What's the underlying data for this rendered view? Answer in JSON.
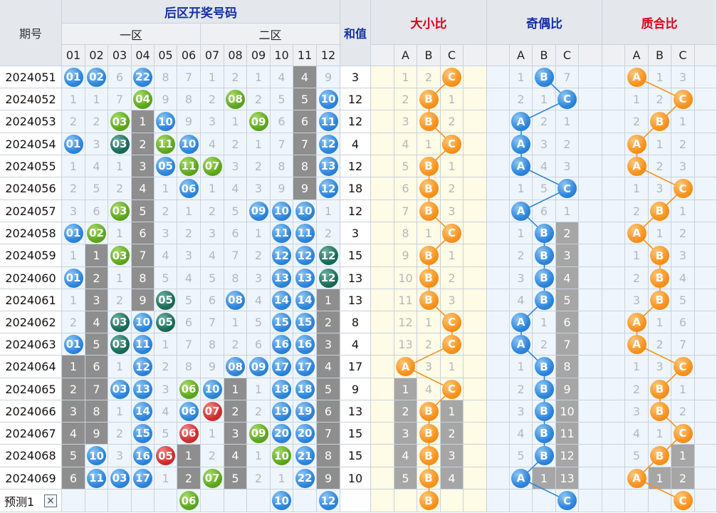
{
  "header": {
    "period_label": "期号",
    "back_zone_title": "后区开奖号码",
    "zone1_label": "一区",
    "zone2_label": "二区",
    "sum_label": "和值",
    "big_small_title": "大小比",
    "odd_even_title": "奇偶比",
    "prime_title": "质合比",
    "number_cols": [
      "01",
      "02",
      "03",
      "04",
      "05",
      "06",
      "07",
      "08",
      "09",
      "10",
      "11",
      "12"
    ],
    "abc": [
      "A",
      "B",
      "C"
    ]
  },
  "rows": [
    {
      "period": "2024051",
      "nums": [
        "01",
        "02",
        "6",
        "22",
        "8",
        "7",
        "1",
        "2",
        "1",
        "4",
        "4",
        "9"
      ],
      "sum": "3",
      "bs": [
        "1",
        "2",
        "C"
      ],
      "oe": [
        "1",
        "B",
        "7"
      ],
      "pr": [
        "A",
        "1",
        "3"
      ]
    },
    {
      "period": "2024052",
      "nums": [
        "1",
        "1",
        "7",
        "04",
        "9",
        "8",
        "2",
        "08",
        "2",
        "5",
        "5",
        "10"
      ],
      "sum": "12",
      "bs": [
        "2",
        "B",
        "1"
      ],
      "oe": [
        "2",
        "1",
        "C"
      ],
      "pr": [
        "1",
        "2",
        "C"
      ]
    },
    {
      "period": "2024053",
      "nums": [
        "2",
        "2",
        "03",
        "1",
        "10",
        "9",
        "3",
        "1",
        "09",
        "6",
        "6",
        "11"
      ],
      "sum": "12",
      "bs": [
        "3",
        "B",
        "2"
      ],
      "oe": [
        "A",
        "2",
        "1"
      ],
      "pr": [
        "2",
        "B",
        "1"
      ]
    },
    {
      "period": "2024054",
      "nums": [
        "01",
        "3",
        "03",
        "2",
        "11",
        "10",
        "4",
        "2",
        "1",
        "7",
        "7",
        "12"
      ],
      "sum": "4",
      "bs": [
        "4",
        "1",
        "C"
      ],
      "oe": [
        "A",
        "3",
        "2"
      ],
      "pr": [
        "A",
        "1",
        "2"
      ]
    },
    {
      "period": "2024055",
      "nums": [
        "1",
        "4",
        "1",
        "3",
        "05",
        "11",
        "07",
        "3",
        "2",
        "8",
        "8",
        "13"
      ],
      "sum": "12",
      "bs": [
        "5",
        "B",
        "1"
      ],
      "oe": [
        "A",
        "4",
        "3"
      ],
      "pr": [
        "A",
        "2",
        "3"
      ]
    },
    {
      "period": "2024056",
      "nums": [
        "2",
        "5",
        "2",
        "4",
        "1",
        "06",
        "1",
        "4",
        "3",
        "9",
        "9",
        "12"
      ],
      "sum": "18",
      "bs": [
        "6",
        "B",
        "2"
      ],
      "oe": [
        "1",
        "5",
        "C"
      ],
      "pr": [
        "1",
        "3",
        "C"
      ]
    },
    {
      "period": "2024057",
      "nums": [
        "3",
        "6",
        "03",
        "5",
        "2",
        "1",
        "2",
        "5",
        "09",
        "10",
        "10",
        "1"
      ],
      "sum": "12",
      "bs": [
        "7",
        "B",
        "3"
      ],
      "oe": [
        "A",
        "6",
        "1"
      ],
      "pr": [
        "2",
        "B",
        "1"
      ]
    },
    {
      "period": "2024058",
      "nums": [
        "01",
        "02",
        "1",
        "6",
        "3",
        "2",
        "3",
        "6",
        "1",
        "11",
        "11",
        "2"
      ],
      "sum": "3",
      "bs": [
        "8",
        "1",
        "C"
      ],
      "oe": [
        "1",
        "B",
        "2"
      ],
      "pr": [
        "A",
        "1",
        "2"
      ]
    },
    {
      "period": "2024059",
      "nums": [
        "1",
        "1",
        "03",
        "7",
        "4",
        "3",
        "4",
        "7",
        "2",
        "12",
        "12",
        "12"
      ],
      "sum": "15",
      "bs": [
        "9",
        "B",
        "1"
      ],
      "oe": [
        "2",
        "B",
        "3"
      ],
      "pr": [
        "1",
        "B",
        "3"
      ]
    },
    {
      "period": "2024060",
      "nums": [
        "01",
        "2",
        "1",
        "8",
        "5",
        "4",
        "5",
        "8",
        "3",
        "13",
        "13",
        "12"
      ],
      "sum": "13",
      "bs": [
        "10",
        "B",
        "2"
      ],
      "oe": [
        "3",
        "B",
        "4"
      ],
      "pr": [
        "2",
        "B",
        "4"
      ]
    },
    {
      "period": "2024061",
      "nums": [
        "1",
        "3",
        "2",
        "9",
        "05",
        "5",
        "6",
        "08",
        "4",
        "14",
        "14",
        "1"
      ],
      "sum": "13",
      "bs": [
        "11",
        "B",
        "3"
      ],
      "oe": [
        "4",
        "B",
        "5"
      ],
      "pr": [
        "3",
        "B",
        "5"
      ]
    },
    {
      "period": "2024062",
      "nums": [
        "2",
        "4",
        "03",
        "10",
        "05",
        "6",
        "7",
        "1",
        "5",
        "15",
        "15",
        "2"
      ],
      "sum": "8",
      "bs": [
        "12",
        "1",
        "C"
      ],
      "oe": [
        "A",
        "1",
        "6"
      ],
      "pr": [
        "A",
        "1",
        "6"
      ]
    },
    {
      "period": "2024063",
      "nums": [
        "01",
        "5",
        "03",
        "11",
        "1",
        "7",
        "8",
        "2",
        "6",
        "16",
        "16",
        "3"
      ],
      "sum": "4",
      "bs": [
        "13",
        "2",
        "C"
      ],
      "oe": [
        "A",
        "2",
        "7"
      ],
      "pr": [
        "A",
        "2",
        "7"
      ]
    },
    {
      "period": "2024064",
      "nums": [
        "1",
        "6",
        "1",
        "12",
        "2",
        "8",
        "9",
        "08",
        "09",
        "17",
        "17",
        "4"
      ],
      "sum": "17",
      "bs": [
        "A",
        "3",
        "1"
      ],
      "oe": [
        "1",
        "B",
        "8"
      ],
      "pr": [
        "1",
        "3",
        "C"
      ]
    },
    {
      "period": "2024065",
      "nums": [
        "2",
        "7",
        "03",
        "13",
        "3",
        "06",
        "10",
        "1",
        "1",
        "18",
        "18",
        "5"
      ],
      "sum": "9",
      "bs": [
        "1",
        "4",
        "C"
      ],
      "oe": [
        "2",
        "B",
        "9"
      ],
      "pr": [
        "2",
        "B",
        "1"
      ]
    },
    {
      "period": "2024066",
      "nums": [
        "3",
        "8",
        "1",
        "14",
        "4",
        "06",
        "07",
        "2",
        "2",
        "19",
        "19",
        "6"
      ],
      "sum": "13",
      "bs": [
        "2",
        "B",
        "1"
      ],
      "oe": [
        "3",
        "B",
        "10"
      ],
      "pr": [
        "3",
        "B",
        "2"
      ]
    },
    {
      "period": "2024067",
      "nums": [
        "4",
        "9",
        "2",
        "15",
        "5",
        "06",
        "1",
        "3",
        "09",
        "20",
        "20",
        "7"
      ],
      "sum": "15",
      "bs": [
        "3",
        "B",
        "2"
      ],
      "oe": [
        "4",
        "B",
        "11"
      ],
      "pr": [
        "4",
        "1",
        "C"
      ]
    },
    {
      "period": "2024068",
      "nums": [
        "5",
        "10",
        "3",
        "16",
        "05",
        "1",
        "2",
        "4",
        "1",
        "10",
        "21",
        "8"
      ],
      "sum": "15",
      "bs": [
        "4",
        "B",
        "3"
      ],
      "oe": [
        "5",
        "B",
        "12"
      ],
      "pr": [
        "5",
        "B",
        "1"
      ]
    },
    {
      "period": "2024069",
      "nums": [
        "6",
        "11",
        "03",
        "17",
        "1",
        "2",
        "07",
        "5",
        "2",
        "1",
        "22",
        "9"
      ],
      "sum": "10",
      "bs": [
        "5",
        "B",
        "4"
      ],
      "oe": [
        "A",
        "1",
        "13"
      ],
      "pr": [
        "A",
        "1",
        "2"
      ]
    }
  ],
  "prediction": {
    "label": "预测1",
    "close_icon": "×",
    "nums": [
      "",
      "",
      "",
      "",
      "",
      "06",
      "",
      "",
      "",
      "10",
      "",
      "12"
    ],
    "bs": [
      "",
      "B",
      ""
    ],
    "oe": [
      "",
      "",
      "C"
    ],
    "pr": [
      "",
      "",
      "C"
    ]
  },
  "colors": {
    "blue": "#2e86dc",
    "green": "#5ea81d",
    "teal": "#1b6c58",
    "red": "#cf2e2e",
    "orange": "#f7931e",
    "gray_box": "#8e8e8e"
  }
}
